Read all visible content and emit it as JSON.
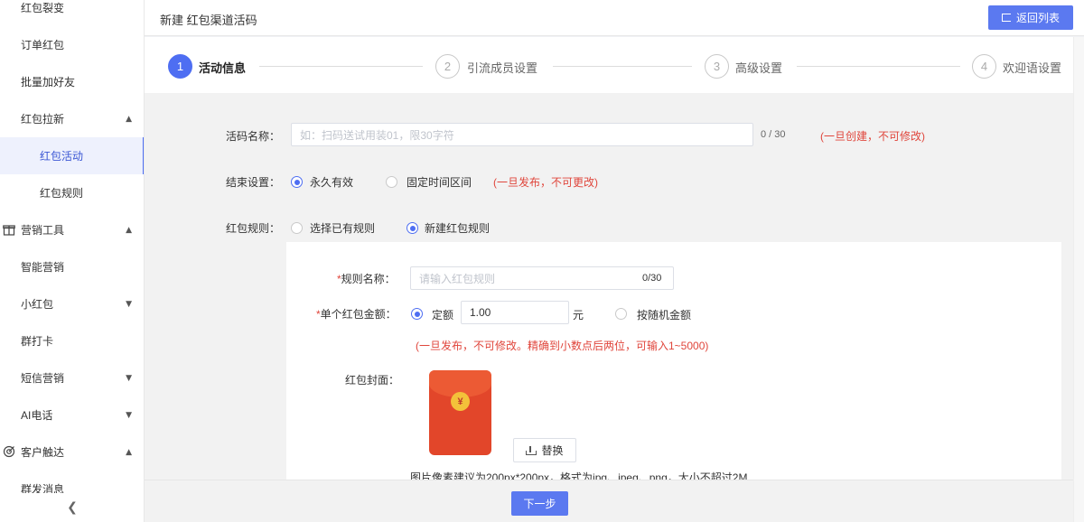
{
  "sidebar": {
    "items": [
      {
        "label": "红包裂变"
      },
      {
        "label": "订单红包"
      },
      {
        "label": "批量加好友"
      },
      {
        "label": "红包拉新",
        "chevron": "up"
      },
      {
        "label": "红包活动",
        "active": true
      },
      {
        "label": "红包规则"
      },
      {
        "label": "营销工具",
        "chevron": "up",
        "icon": "gift-icon"
      },
      {
        "label": "智能营销"
      },
      {
        "label": "小红包",
        "chevron": "down"
      },
      {
        "label": "群打卡"
      },
      {
        "label": "短信营销",
        "chevron": "down"
      },
      {
        "label": "AI电话",
        "chevron": "down"
      },
      {
        "label": "客户触达",
        "chevron": "up",
        "icon": "target-icon"
      },
      {
        "label": "群发消息"
      }
    ],
    "collapse_icon": "chevron-left-icon"
  },
  "header": {
    "title": "新建 红包渠道活码",
    "back_button": "返回列表"
  },
  "steps": [
    {
      "num": "1",
      "label": "活动信息",
      "active": true
    },
    {
      "num": "2",
      "label": "引流成员设置"
    },
    {
      "num": "3",
      "label": "高级设置"
    },
    {
      "num": "4",
      "label": "欢迎语设置"
    }
  ],
  "form": {
    "code_name": {
      "label": "活码名称：",
      "placeholder": "如：扫码送试用装01，限30字符",
      "counter": "0 / 30",
      "warn": "(一旦创建，不可修改)"
    },
    "end_setting": {
      "label": "结束设置：",
      "options": [
        "永久有效",
        "固定时间区间"
      ],
      "selected": "永久有效",
      "warn": "(一旦发布，不可更改)"
    },
    "rule": {
      "label": "红包规则：",
      "options": [
        "选择已有规则",
        "新建红包规则"
      ],
      "selected": "新建红包规则"
    },
    "rule_name": {
      "required": "*",
      "label": "规则名称：",
      "placeholder": "请输入红包规则",
      "counter": "0/30"
    },
    "amount": {
      "required": "*",
      "label": "单个红包金额：",
      "options": [
        "定额",
        "按随机金额"
      ],
      "selected": "定额",
      "value": "1.00",
      "unit": "元",
      "warn": "(一旦发布，不可修改。精确到小数点后两位，可输入1~5000)"
    },
    "cover": {
      "label": "红包封面：",
      "coin_symbol": "¥",
      "replace_button": "替换",
      "hint": "图片像素建议为200px*200px，格式为jpg、jpeg、png，大小不超过2M"
    }
  },
  "footer": {
    "next_button": "下一步"
  },
  "colors": {
    "primary": "#4e6ef2",
    "warning": "#e0463c",
    "envelope": "#e2462a"
  }
}
